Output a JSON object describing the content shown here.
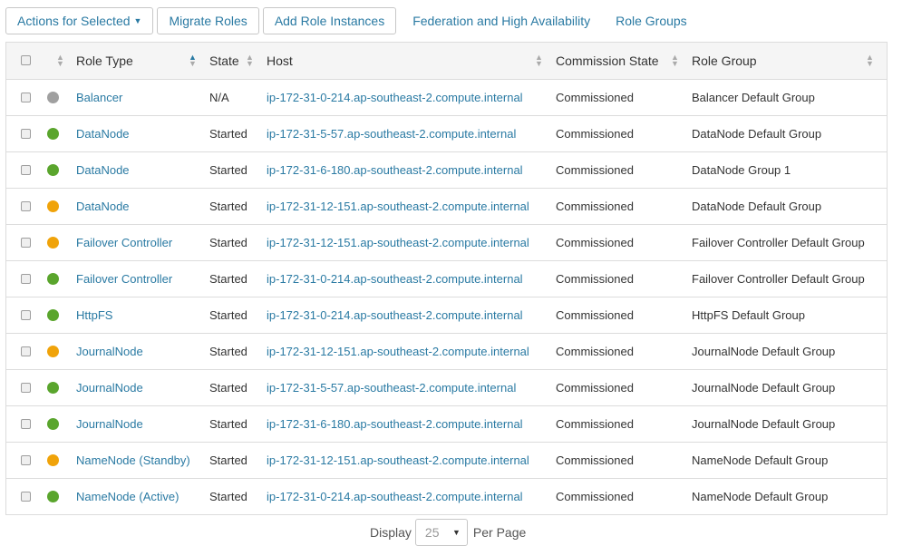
{
  "toolbar": {
    "actions_label": "Actions for Selected",
    "migrate_label": "Migrate Roles",
    "add_label": "Add Role Instances",
    "federation_label": "Federation and High Availability",
    "role_groups_label": "Role Groups"
  },
  "table": {
    "columns": {
      "role_type": "Role Type",
      "state": "State",
      "host": "Host",
      "commission_state": "Commission State",
      "role_group": "Role Group"
    },
    "status_colors": {
      "gray": "#a0a0a0",
      "green": "#5aa52d",
      "orange": "#f0a30a"
    },
    "rows": [
      {
        "status": "gray",
        "role_type": "Balancer",
        "state": "N/A",
        "host": "ip-172-31-0-214.ap-southeast-2.compute.internal",
        "commission": "Commissioned",
        "group": "Balancer Default Group"
      },
      {
        "status": "green",
        "role_type": "DataNode",
        "state": "Started",
        "host": "ip-172-31-5-57.ap-southeast-2.compute.internal",
        "commission": "Commissioned",
        "group": "DataNode Default Group"
      },
      {
        "status": "green",
        "role_type": "DataNode",
        "state": "Started",
        "host": "ip-172-31-6-180.ap-southeast-2.compute.internal",
        "commission": "Commissioned",
        "group": "DataNode Group 1"
      },
      {
        "status": "orange",
        "role_type": "DataNode",
        "state": "Started",
        "host": "ip-172-31-12-151.ap-southeast-2.compute.internal",
        "commission": "Commissioned",
        "group": "DataNode Default Group"
      },
      {
        "status": "orange",
        "role_type": "Failover Controller",
        "state": "Started",
        "host": "ip-172-31-12-151.ap-southeast-2.compute.internal",
        "commission": "Commissioned",
        "group": "Failover Controller Default Group"
      },
      {
        "status": "green",
        "role_type": "Failover Controller",
        "state": "Started",
        "host": "ip-172-31-0-214.ap-southeast-2.compute.internal",
        "commission": "Commissioned",
        "group": "Failover Controller Default Group"
      },
      {
        "status": "green",
        "role_type": "HttpFS",
        "state": "Started",
        "host": "ip-172-31-0-214.ap-southeast-2.compute.internal",
        "commission": "Commissioned",
        "group": "HttpFS Default Group"
      },
      {
        "status": "orange",
        "role_type": "JournalNode",
        "state": "Started",
        "host": "ip-172-31-12-151.ap-southeast-2.compute.internal",
        "commission": "Commissioned",
        "group": "JournalNode Default Group"
      },
      {
        "status": "green",
        "role_type": "JournalNode",
        "state": "Started",
        "host": "ip-172-31-5-57.ap-southeast-2.compute.internal",
        "commission": "Commissioned",
        "group": "JournalNode Default Group"
      },
      {
        "status": "green",
        "role_type": "JournalNode",
        "state": "Started",
        "host": "ip-172-31-6-180.ap-southeast-2.compute.internal",
        "commission": "Commissioned",
        "group": "JournalNode Default Group"
      },
      {
        "status": "orange",
        "role_type": "NameNode (Standby)",
        "state": "Started",
        "host": "ip-172-31-12-151.ap-southeast-2.compute.internal",
        "commission": "Commissioned",
        "group": "NameNode Default Group"
      },
      {
        "status": "green",
        "role_type": "NameNode (Active)",
        "state": "Started",
        "host": "ip-172-31-0-214.ap-southeast-2.compute.internal",
        "commission": "Commissioned",
        "group": "NameNode Default Group"
      }
    ]
  },
  "pager": {
    "display_label": "Display",
    "page_size": "25",
    "per_page_label": "Per Page"
  }
}
